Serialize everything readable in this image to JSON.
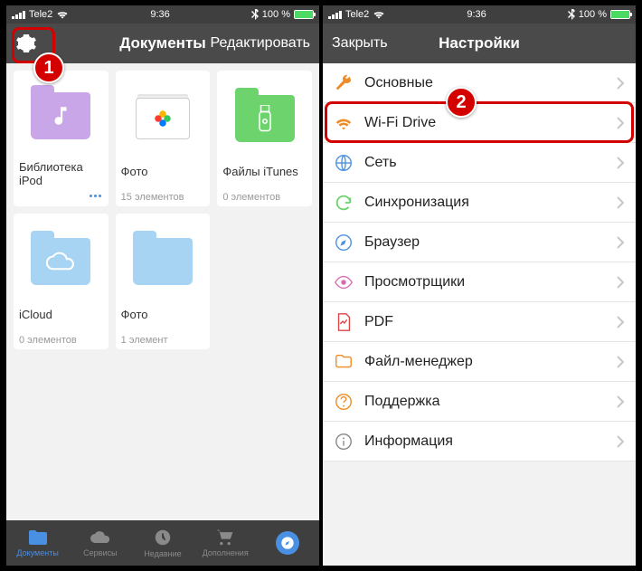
{
  "status": {
    "carrier": "Tele2",
    "time": "9:36",
    "battery": "100 %"
  },
  "left": {
    "title": "Документы",
    "edit": "Редактировать",
    "tiles": [
      {
        "name": "Библиотека iPod",
        "folder": "purple",
        "glyph": "music",
        "dots": true
      },
      {
        "name": "Фото",
        "folder": "white",
        "glyph": "photos",
        "count": "15 элементов"
      },
      {
        "name": "Файлы iTunes",
        "folder": "green",
        "glyph": "usb",
        "count": "0 элементов"
      },
      {
        "name": "iCloud",
        "folder": "blue",
        "glyph": "cloud",
        "count": "0 элементов"
      },
      {
        "name": "Фото",
        "folder": "blue",
        "glyph": "",
        "count": "1 элемент"
      }
    ],
    "tabs": [
      {
        "label": "Документы",
        "icon": "folder",
        "active": true
      },
      {
        "label": "Сервисы",
        "icon": "cloud"
      },
      {
        "label": "Недавние",
        "icon": "clock"
      },
      {
        "label": "Дополнения",
        "icon": "cart"
      },
      {
        "label": "",
        "icon": "browser"
      }
    ]
  },
  "right": {
    "close": "Закрыть",
    "title": "Настройки",
    "items": [
      {
        "label": "Основные",
        "icon": "wrench",
        "color": "#f08a24"
      },
      {
        "label": "Wi-Fi Drive",
        "icon": "wifi",
        "color": "#f08a24",
        "highlight": true
      },
      {
        "label": "Сеть",
        "icon": "globe",
        "color": "#4a90e2"
      },
      {
        "label": "Синхронизация",
        "icon": "sync",
        "color": "#6dd46d"
      },
      {
        "label": "Браузер",
        "icon": "compass",
        "color": "#4a90e2"
      },
      {
        "label": "Просмотрщики",
        "icon": "eye",
        "color": "#d66bb5"
      },
      {
        "label": "PDF",
        "icon": "pdf",
        "color": "#d44"
      },
      {
        "label": "Файл-менеджер",
        "icon": "folderline",
        "color": "#f08a24"
      },
      {
        "label": "Поддержка",
        "icon": "question",
        "color": "#f08a24"
      },
      {
        "label": "Информация",
        "icon": "info",
        "color": "#888"
      }
    ]
  },
  "callouts": {
    "n1": "1",
    "n2": "2"
  }
}
